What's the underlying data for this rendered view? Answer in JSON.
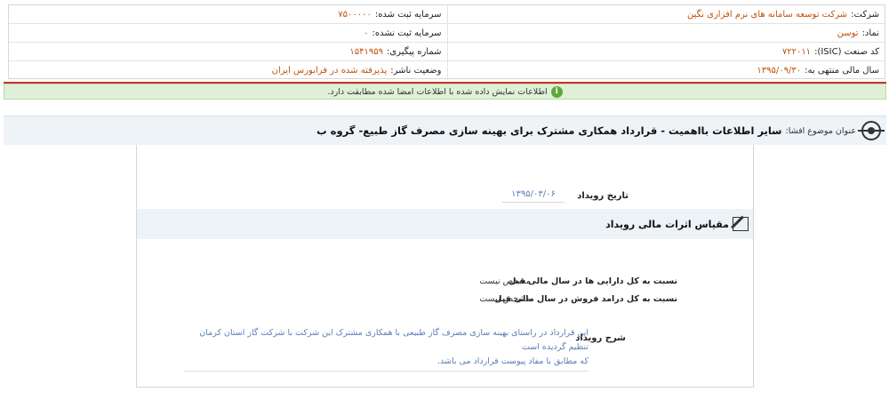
{
  "company_info": {
    "company": {
      "label": "شرکت:",
      "value": "شرکت توسعه سامانه های نرم افزاری نگین"
    },
    "registered_capital": {
      "label": "سرمایه ثبت شده:",
      "value": "۷۵۰۰۰۰۰"
    },
    "symbol": {
      "label": "نماد:",
      "value": "توسن"
    },
    "unregistered_capital": {
      "label": "سرمایه ثبت نشده:",
      "value": "۰"
    },
    "isic": {
      "label": "کد صنعت (ISIC):",
      "value": "۷۲۲۰۱۱"
    },
    "tracking": {
      "label": "شماره پیگیری:",
      "value": "۱۵۴۱۹۵۹"
    },
    "fiscal_year": {
      "label": "سال مالی منتهی به:",
      "value": "۱۳۹۵/۰۹/۳۰"
    },
    "publisher_status": {
      "label": "وضعیت ناشر:",
      "value": "پذیرفته شده در فرابورس ایران"
    }
  },
  "alert": {
    "text": "اطلاعات نمایش داده شده با اطلاعات امضا شده مطابقت دارد.",
    "icon": "info-icon",
    "color": "#dff0d8"
  },
  "subject": {
    "label": "عنوان موضوع افشا:",
    "title": "سایر اطلاعات بااهمیت - قرارداد همکاری مشترک برای بهینه سازی مصرف گاز طبیع- گروه ب"
  },
  "event": {
    "date_label": "تاریخ رویداد",
    "date_value": "۱۳۹۵/۰۳/۰۶"
  },
  "section": {
    "title": "مقیاس اثرات مالی رویداد"
  },
  "ratios": [
    {
      "label": "نسبت به کل دارایی ها در سال مالی قبل",
      "value": "مشخص نیست"
    },
    {
      "label": "نسبت به کل درامد فروش در سال مالی قبل",
      "value": "مشخص نیست"
    }
  ],
  "description": {
    "label": "شرح رویداد",
    "line1": "این قرارداد در راستای بهینه سازی مصرف گاز طبیعی با همکاری مشترک این شرکت با شرکت گاز استان کرمان تنظیم گردیده است",
    "line2": "که مطابق با مفاد پیوست قرارداد می باشد."
  }
}
